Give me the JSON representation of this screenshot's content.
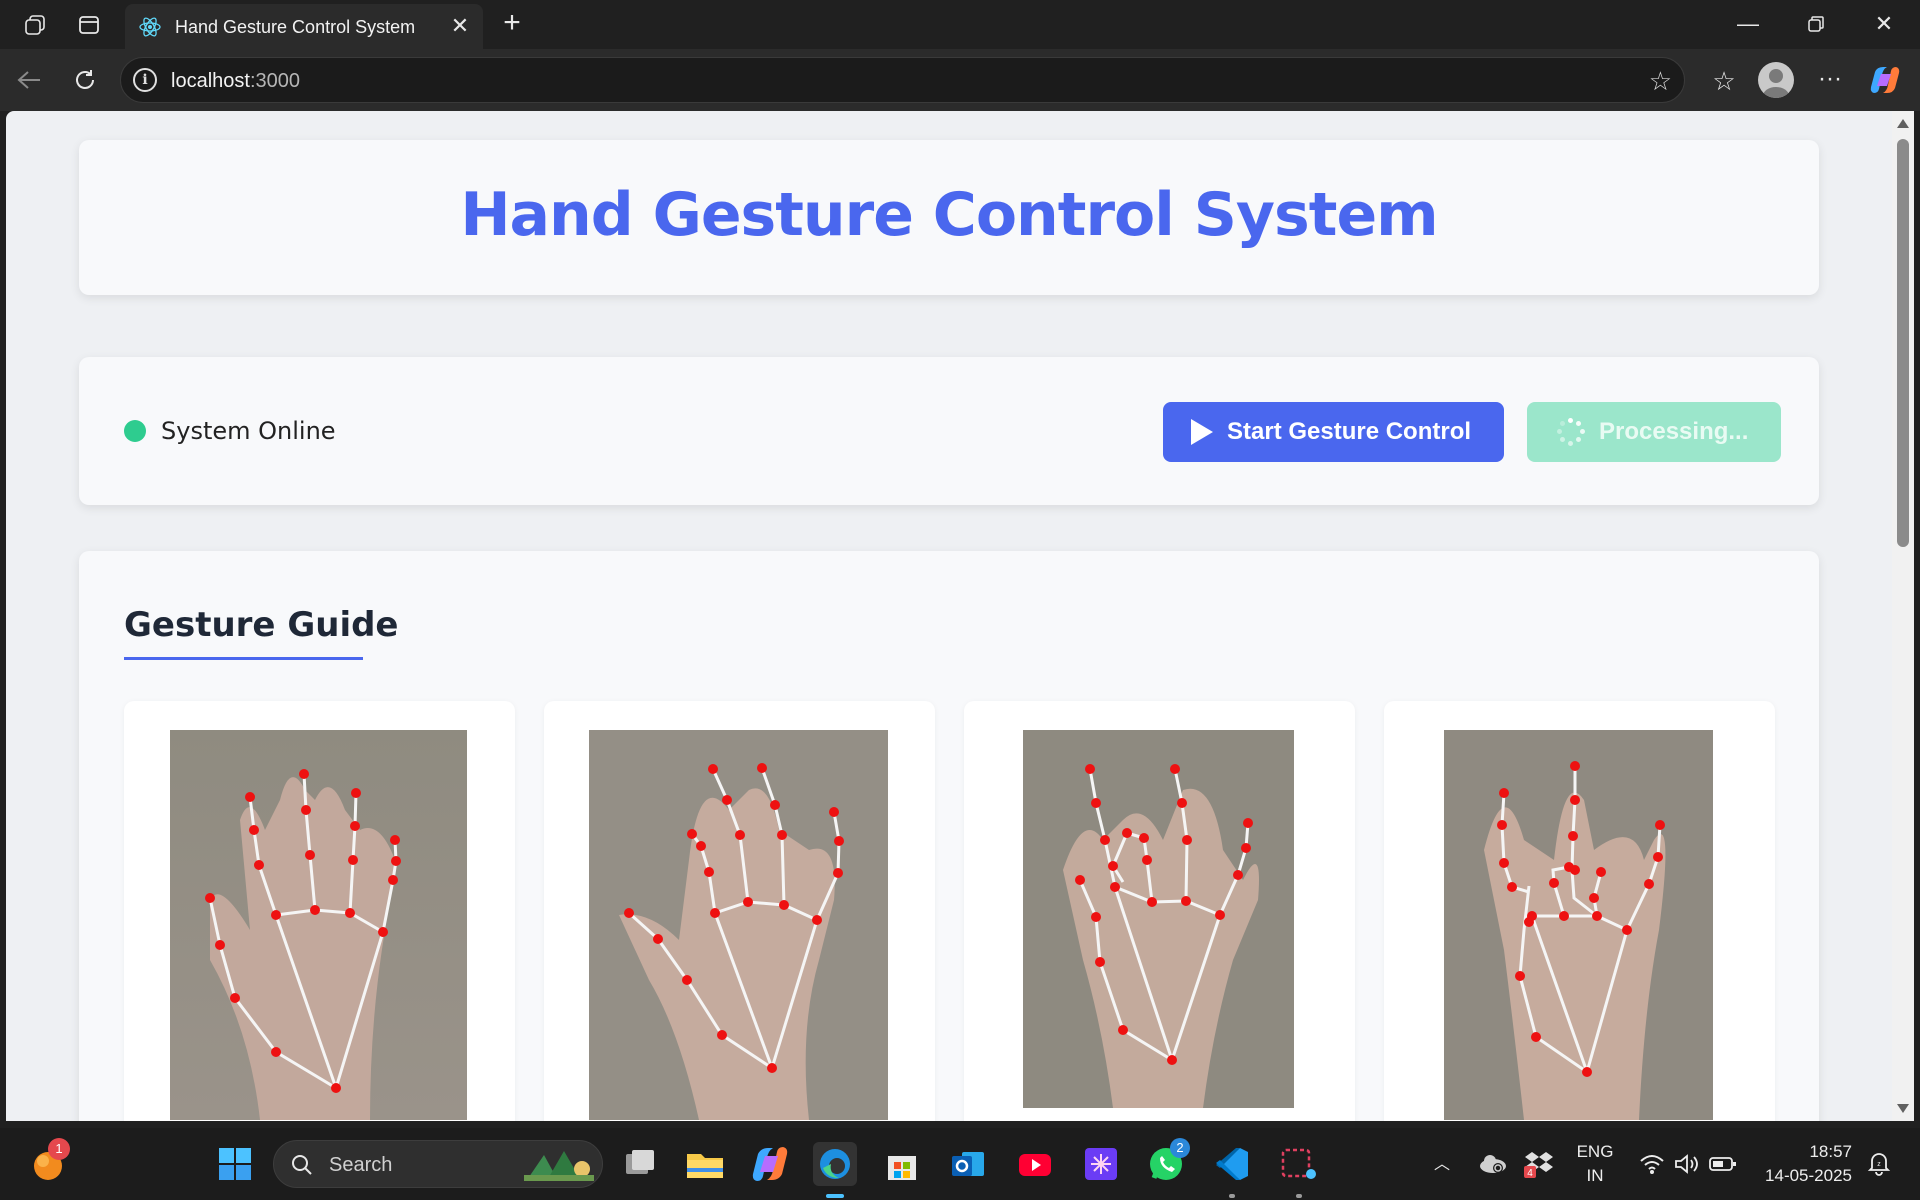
{
  "browser": {
    "tab_title": "Hand Gesture Control System",
    "url_host": "localhost",
    "url_port": ":3000"
  },
  "app": {
    "title": "Hand Gesture Control System",
    "status_text": "System Online",
    "start_button": "Start Gesture Control",
    "processing_button": "Processing...",
    "guide_title": "Gesture Guide"
  },
  "colors": {
    "accent": "#4a67ee",
    "online": "#2ecc8f",
    "processing": "#9be6cb"
  },
  "taskbar": {
    "search_placeholder": "Search",
    "notification_count": "1",
    "whatsapp_badge": "2",
    "lang_top": "ENG",
    "lang_bottom": "IN",
    "time": "18:57",
    "date": "14-05-2025"
  }
}
